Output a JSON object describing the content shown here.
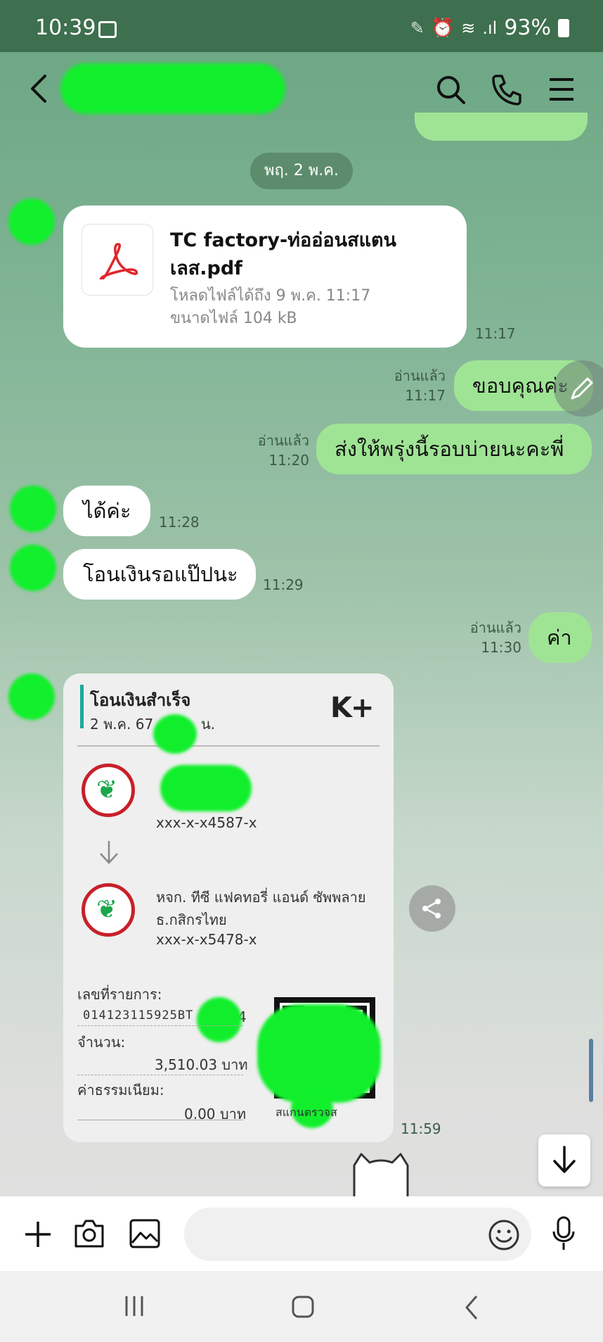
{
  "status_bar": {
    "time": "10:39",
    "battery": "93%"
  },
  "chat": {
    "date_separator": "พฤ. 2 พ.ค.",
    "file_message": {
      "name": "TC factory-ท่ออ่อนสแตนเลส.pdf",
      "name_line1": "TC factory-ท่ออ่อนสแตน",
      "name_line2": "เลส.pdf",
      "download_until": "โหลดไฟล์ได้ถึง 9 พ.ค. 11:17",
      "size": "ขนาดไฟล์ 104 kB",
      "time": "11:17"
    },
    "outgoing_1": {
      "read": "อ่านแล้ว",
      "time": "11:17",
      "text": "ขอบคุณค่ะ"
    },
    "outgoing_2": {
      "read": "อ่านแล้ว",
      "time": "11:20",
      "text": "ส่งให้พรุ่งนี้รอบบ่ายนะคะพี่"
    },
    "incoming_1": {
      "text": "ได้ค่ะ",
      "time": "11:28"
    },
    "incoming_2": {
      "text": "โอนเงินรอแป๊ปนะ",
      "time": "11:29"
    },
    "outgoing_3": {
      "read": "อ่านแล้ว",
      "time": "11:30",
      "text": "ค่า"
    },
    "slip": {
      "title": "โอนเงินสำเร็จ",
      "date": "2 พ.ค. 67",
      "date_suffix": "น.",
      "brand": "K+",
      "from_account": "xxx-x-x4587-x",
      "to_name": "หจก. ทีซี แฟคทอรี่ แอนด์ ซัพพลาย",
      "to_bank": "ธ.กสิกรไทย",
      "to_account": "xxx-x-x5478-x",
      "ref_label": "เลขที่รายการ:",
      "ref_value": "014123115925BT",
      "ref_tail": "4",
      "amount_label": "จำนวน:",
      "amount_value": "3,510.03 บาท",
      "fee_label": "ค่าธรรมเนียม:",
      "fee_value": "0.00 บาท",
      "qr_caption": "สแกนตรวจส",
      "time": "11:59"
    }
  },
  "colors": {
    "accent_green": "#06c755",
    "outgoing_bubble": "#9fe495",
    "redaction": "#11ef2c"
  },
  "icons": [
    "back-arrow-icon",
    "search-icon",
    "phone-icon",
    "menu-icon",
    "pdf-icon",
    "pencil-icon",
    "share-icon",
    "scroll-down-icon",
    "plus-icon",
    "camera-icon",
    "image-icon",
    "emoji-icon",
    "mic-icon",
    "recent-apps-icon",
    "home-icon",
    "nav-back-icon"
  ]
}
